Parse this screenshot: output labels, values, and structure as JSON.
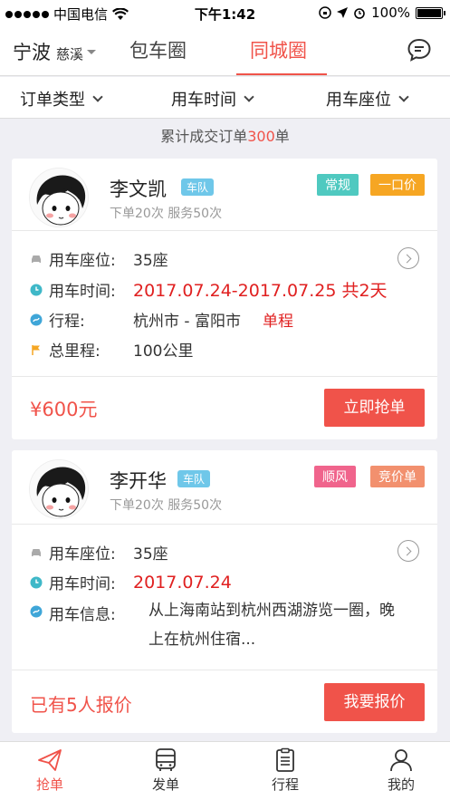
{
  "status_bar": {
    "carrier": "中国电信",
    "time": "下午1:42",
    "battery": "100%"
  },
  "top_nav": {
    "city": "宁波",
    "district": "慈溪",
    "tabs": [
      {
        "label": "包车圈",
        "active": false
      },
      {
        "label": "同城圈",
        "active": true
      }
    ],
    "message_icon": "chat-bubble-icon"
  },
  "filters": [
    "订单类型",
    "用车时间",
    "用车座位"
  ],
  "summary": {
    "prefix": "累计成交订单",
    "count": "300",
    "suffix": "单"
  },
  "cards": [
    {
      "name": "李文凯",
      "team_badge": "车队",
      "stats": "下单20次 服务50次",
      "tags": [
        {
          "label": "常规",
          "color": "#4fc9c0"
        },
        {
          "label": "一口价",
          "color": "#f6a623"
        }
      ],
      "rows": [
        {
          "icon": "car-icon",
          "label": "用车座位:",
          "value": "35座",
          "highlight": false,
          "extra": ""
        },
        {
          "icon": "clock-icon",
          "label": "用车时间:",
          "value": "2017.07.24-2017.07.25 共2天",
          "highlight": true,
          "extra": ""
        },
        {
          "icon": "route-icon",
          "label": "行程:",
          "value": "杭州市 - 富阳市",
          "highlight": false,
          "extra": "单程"
        },
        {
          "icon": "flag-icon",
          "label": "总里程:",
          "value": "100公里",
          "highlight": false,
          "extra": ""
        }
      ],
      "price": "¥600元",
      "action": "立即抢单"
    },
    {
      "name": "李开华",
      "team_badge": "车队",
      "stats": "下单20次 服务50次",
      "tags": [
        {
          "label": "顺风",
          "color": "#f0648c"
        },
        {
          "label": "竞价单",
          "color": "#f2906e"
        }
      ],
      "rows": [
        {
          "icon": "car-icon",
          "label": "用车座位:",
          "value": "35座",
          "highlight": false,
          "extra": ""
        },
        {
          "icon": "clock-icon",
          "label": "用车时间:",
          "value": "2017.07.24",
          "highlight": true,
          "extra": ""
        },
        {
          "icon": "route-icon",
          "label": "用车信息:",
          "value": "从上海南站到杭州西湖游览一圈，晚",
          "value2": "上在杭州住宿...",
          "highlight": false,
          "extra": ""
        }
      ],
      "price": "已有5人报价",
      "action": "我要报价"
    }
  ],
  "tab_bar": [
    {
      "label": "抢单",
      "icon": "paper-plane-icon",
      "active": true
    },
    {
      "label": "发单",
      "icon": "bus-icon",
      "active": false
    },
    {
      "label": "行程",
      "icon": "clipboard-icon",
      "active": false
    },
    {
      "label": "我的",
      "icon": "person-icon",
      "active": false
    }
  ],
  "colors": {
    "accent": "#f0534a",
    "team_badge": "#6fc7e9",
    "clock": "#3fb8c8",
    "route": "#3fa6d8",
    "flag": "#f5a623"
  }
}
